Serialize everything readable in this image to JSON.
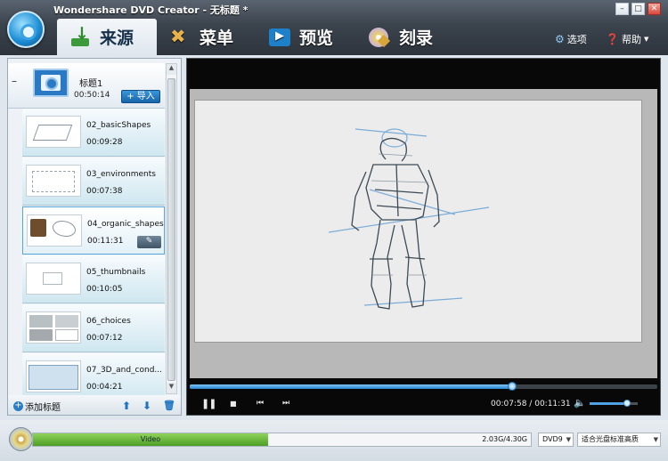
{
  "app": {
    "title": "Wondershare DVD Creator - 无标题 *"
  },
  "window_buttons": {
    "minimize": "–",
    "maximize": "□",
    "close": "✕"
  },
  "tabs": [
    {
      "label": "来源",
      "icon": "import-icon",
      "active": true
    },
    {
      "label": "菜单",
      "icon": "tools-icon",
      "active": false
    },
    {
      "label": "预览",
      "icon": "preview-icon",
      "active": false
    },
    {
      "label": "刻录",
      "icon": "burn-disc-icon",
      "active": false
    }
  ],
  "header_links": {
    "options": "选项",
    "help": "帮助"
  },
  "title_item": {
    "name": "标题1",
    "duration": "00:50:14",
    "import_label": "+ 导入",
    "collapse": "–"
  },
  "clips": [
    {
      "name": "02_basicShapes",
      "duration": "00:09:28",
      "selected": false,
      "thumb": "shapes"
    },
    {
      "name": "03_environments",
      "duration": "00:07:38",
      "selected": false,
      "thumb": "env"
    },
    {
      "name": "04_organic_shapes",
      "duration": "00:11:31",
      "selected": true,
      "thumb": "organic"
    },
    {
      "name": "05_thumbnails",
      "duration": "00:10:05",
      "selected": false,
      "thumb": "thumbs"
    },
    {
      "name": "06_choices",
      "duration": "00:07:12",
      "selected": false,
      "thumb": "choices"
    },
    {
      "name": "07_3D_and_cond...",
      "duration": "00:04:21",
      "selected": false,
      "thumb": "3d"
    }
  ],
  "left_footer": {
    "add_title": "添加标题"
  },
  "player": {
    "current_time": "00:07:58",
    "separator": "/",
    "total_time": "00:11:31",
    "progress": 0.69,
    "volume": 0.78
  },
  "status": {
    "type_label": "Video",
    "capacity_text": "2.03G/4.30G",
    "used_fraction": 0.472,
    "disc_type": "DVD9",
    "quality": "适合光盘标准高质"
  },
  "colors": {
    "accent": "#2a86cf",
    "capacity_fill": "#4d9e25"
  }
}
